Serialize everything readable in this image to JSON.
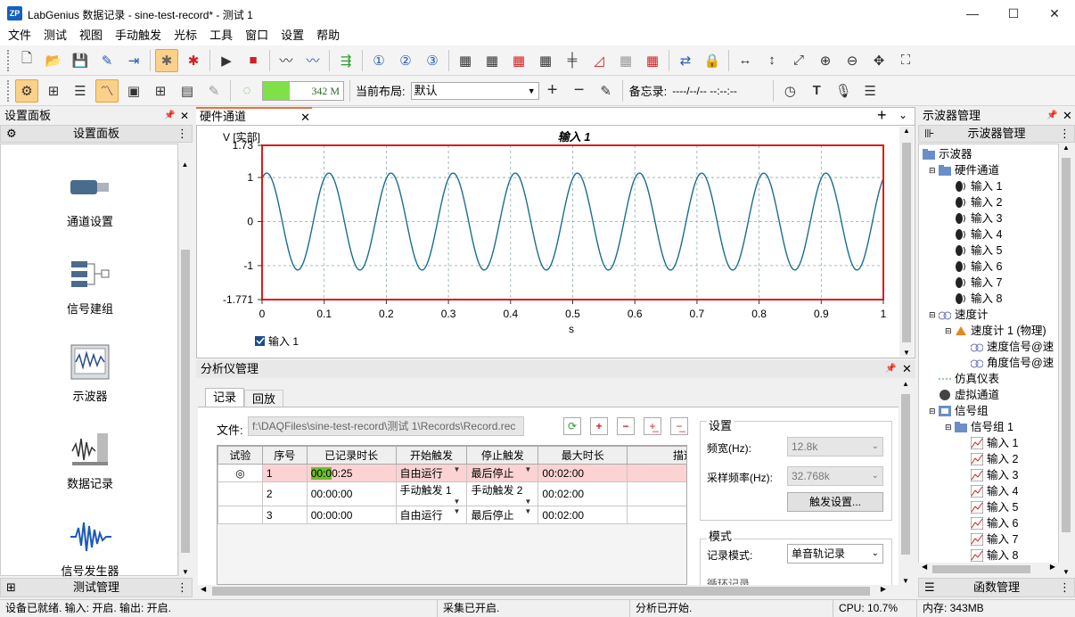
{
  "app": {
    "title": "LabGenius 数据记录 - sine-test-record* - 测试 1",
    "logo": "ZP"
  },
  "window_controls": {
    "minimize": "—",
    "maximize": "☐",
    "close": "✕"
  },
  "menu": [
    "文件",
    "测试",
    "视图",
    "手动触发",
    "光标",
    "工具",
    "窗口",
    "设置",
    "帮助"
  ],
  "toolbar2": {
    "progress_label": "342 M",
    "progress_fraction": 0.33,
    "layout_label": "当前布局:",
    "layout_value": "默认",
    "memo_label": "备忘录:",
    "memo_value": "----/--/-- --:--:--"
  },
  "left_panel": {
    "title": "设置面板",
    "subtitle": "设置面板",
    "items": [
      {
        "label": "通道设置",
        "icon": "channel-icon"
      },
      {
        "label": "信号建组",
        "icon": "group-icon"
      },
      {
        "label": "示波器",
        "icon": "scope-icon"
      },
      {
        "label": "数据记录",
        "icon": "recorder-icon"
      },
      {
        "label": "信号发生器",
        "icon": "generator-icon"
      }
    ],
    "bottom": "测试管理"
  },
  "doc_tab": {
    "label": "硬件通道"
  },
  "chart_data": {
    "type": "line",
    "title": "输入 1",
    "ylabel": "V [实部]",
    "xlabel": "s",
    "ylim": [
      -1.771,
      1.73
    ],
    "xlim": [
      0,
      1
    ],
    "y_ticks": [
      "1.73",
      "1",
      "0",
      "-1",
      "-1.771"
    ],
    "x_ticks": [
      "0",
      "0.1",
      "0.2",
      "0.3",
      "0.4",
      "0.5",
      "0.6",
      "0.7",
      "0.8",
      "0.9",
      "1"
    ],
    "series": [
      {
        "name": "输入 1",
        "frequency_hz": 10,
        "amplitude": 1.1,
        "color": "#1a6e8e"
      }
    ],
    "legend": "bottom-left",
    "grid": true,
    "border_color": "#e21a1a"
  },
  "analyzer": {
    "title": "分析仪管理",
    "tabs": [
      "记录",
      "回放"
    ],
    "file_label": "文件:",
    "file_path": "f:\\DAQFiles\\sine-test-record\\测试 1\\Records\\Record.rec",
    "columns": [
      "试验",
      "序号",
      "已记录时长",
      "开始触发",
      "停止触发",
      "最大时长",
      "描述"
    ],
    "rows": [
      {
        "no": "1",
        "dur_hl": "00:0",
        "dur_rest": "0:25",
        "start": "自由运行",
        "stop": "最后停止",
        "max": "00:02:00",
        "desc": ""
      },
      {
        "no": "2",
        "dur_hl": "",
        "dur_rest": "00:00:00",
        "start": "手动触发 1",
        "stop": "手动触发 2",
        "max": "00:02:00",
        "desc": ""
      },
      {
        "no": "3",
        "dur_hl": "",
        "dur_rest": "00:00:00",
        "start": "自由运行",
        "stop": "最后停止",
        "max": "00:02:00",
        "desc": ""
      }
    ],
    "settings": {
      "title": "设置",
      "bandwidth_label": "频宽(Hz):",
      "bandwidth_value": "12.8k",
      "rate_label": "采样频率(Hz):",
      "rate_value": "32.768k",
      "trigger_btn": "触发设置..."
    },
    "mode": {
      "title": "模式",
      "label": "记录模式:",
      "value": "单音轨记录",
      "cut_label": "循环记录"
    }
  },
  "right_panel": {
    "title": "示波器管理",
    "subtitle": "示波器管理",
    "bottom": "函数管理",
    "tree": [
      {
        "t": "示波器",
        "lvl": 0,
        "ic": "folder"
      },
      {
        "t": "硬件通道",
        "lvl": 1,
        "ic": "folder"
      },
      {
        "t": "输入 1",
        "lvl": 2,
        "ic": "ch"
      },
      {
        "t": "输入 2",
        "lvl": 2,
        "ic": "ch"
      },
      {
        "t": "输入 3",
        "lvl": 2,
        "ic": "ch"
      },
      {
        "t": "输入 4",
        "lvl": 2,
        "ic": "ch"
      },
      {
        "t": "输入 5",
        "lvl": 2,
        "ic": "ch"
      },
      {
        "t": "输入 6",
        "lvl": 2,
        "ic": "ch"
      },
      {
        "t": "输入 7",
        "lvl": 2,
        "ic": "ch"
      },
      {
        "t": "输入 8",
        "lvl": 2,
        "ic": "ch"
      },
      {
        "t": "速度计",
        "lvl": 1,
        "ic": "speed"
      },
      {
        "t": "速度计 1 (物理)",
        "lvl": 2,
        "ic": "tacho"
      },
      {
        "t": "速度信号@速",
        "lvl": 3,
        "ic": "speed"
      },
      {
        "t": "角度信号@速",
        "lvl": 3,
        "ic": "speed"
      },
      {
        "t": "仿真仪表",
        "lvl": 1,
        "ic": "sim"
      },
      {
        "t": "虚拟通道",
        "lvl": 1,
        "ic": "virtual"
      },
      {
        "t": "信号组",
        "lvl": 1,
        "ic": "group"
      },
      {
        "t": "信号组 1",
        "lvl": 2,
        "ic": "folder"
      },
      {
        "t": "输入 1",
        "lvl": 3,
        "ic": "wave"
      },
      {
        "t": "输入 2",
        "lvl": 3,
        "ic": "wave"
      },
      {
        "t": "输入 3",
        "lvl": 3,
        "ic": "wave"
      },
      {
        "t": "输入 4",
        "lvl": 3,
        "ic": "wave"
      },
      {
        "t": "输入 5",
        "lvl": 3,
        "ic": "wave"
      },
      {
        "t": "输入 6",
        "lvl": 3,
        "ic": "wave"
      },
      {
        "t": "输入 7",
        "lvl": 3,
        "ic": "wave"
      },
      {
        "t": "输入 8",
        "lvl": 3,
        "ic": "wave"
      }
    ]
  },
  "status": {
    "left": "设备已就绪. 输入: 开启. 输出: 开启.",
    "acq": "采集已开启.",
    "analysis": "分析已开始.",
    "cpu": "CPU: 10.7%",
    "mem": "内存: 343MB"
  }
}
